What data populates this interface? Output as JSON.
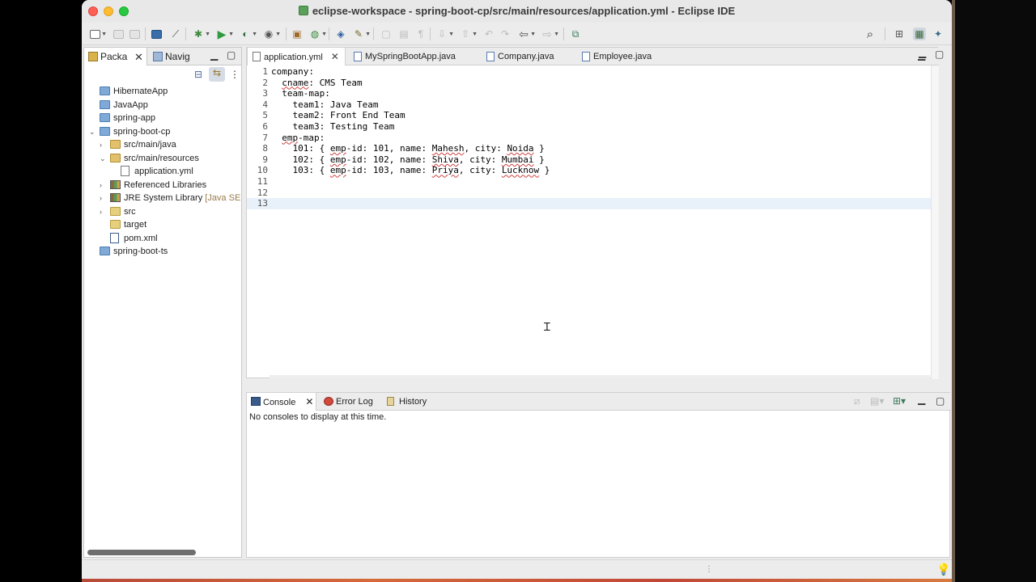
{
  "window": {
    "title": "eclipse-workspace - spring-boot-cp/src/main/resources/application.yml - Eclipse IDE"
  },
  "colors": {
    "accent": "#4a7fc1",
    "close": "#fe5f57",
    "minimize": "#febc2e",
    "maximize": "#28c840"
  },
  "left_panel": {
    "tabs": [
      {
        "label": "Packa",
        "icon": "package-explorer-icon",
        "active": true
      },
      {
        "label": "Navig",
        "icon": "navigator-icon",
        "active": false
      }
    ],
    "tree": [
      {
        "label": "HibernateApp",
        "icon": "project-icon",
        "indent": 0,
        "twisty": ""
      },
      {
        "label": "JavaApp",
        "icon": "project-icon",
        "indent": 0,
        "twisty": ""
      },
      {
        "label": "spring-app",
        "icon": "project-icon",
        "indent": 0,
        "twisty": ""
      },
      {
        "label": "spring-boot-cp",
        "icon": "project-icon",
        "indent": 0,
        "twisty": "⌄"
      },
      {
        "label": "src/main/java",
        "icon": "source-folder-icon",
        "indent": 1,
        "twisty": "›"
      },
      {
        "label": "src/main/resources",
        "icon": "source-folder-icon",
        "indent": 1,
        "twisty": "⌄"
      },
      {
        "label": "application.yml",
        "icon": "yaml-file-icon",
        "indent": 2,
        "twisty": ""
      },
      {
        "label": "Referenced Libraries",
        "icon": "library-icon",
        "indent": 1,
        "twisty": "›"
      },
      {
        "label": "JRE System Library",
        "suffix": "[Java SE",
        "icon": "library-icon",
        "indent": 1,
        "twisty": "›"
      },
      {
        "label": "src",
        "icon": "folder-icon",
        "indent": 1,
        "twisty": "›"
      },
      {
        "label": "target",
        "icon": "folder-icon",
        "indent": 1,
        "twisty": ""
      },
      {
        "label": "pom.xml",
        "icon": "maven-file-icon",
        "indent": 1,
        "twisty": ""
      },
      {
        "label": "spring-boot-ts",
        "icon": "project-icon",
        "indent": 0,
        "twisty": ""
      }
    ]
  },
  "editor": {
    "tabs": [
      {
        "label": "application.yml",
        "icon": "yaml-file-icon",
        "active": true
      },
      {
        "label": "MySpringBootApp.java",
        "icon": "java-file-icon",
        "active": false
      },
      {
        "label": "Company.java",
        "icon": "java-file-icon",
        "active": false
      },
      {
        "label": "Employee.java",
        "icon": "java-file-icon",
        "active": false
      }
    ],
    "lines": [
      {
        "n": "1",
        "text": "company:"
      },
      {
        "n": "2",
        "text": "  cname: CMS Team"
      },
      {
        "n": "3",
        "text": "  team-map:"
      },
      {
        "n": "4",
        "text": "    team1: Java Team"
      },
      {
        "n": "5",
        "text": "    team2: Front End Team"
      },
      {
        "n": "6",
        "text": "    team3: Testing Team"
      },
      {
        "n": "7",
        "text": "  emp-map:"
      },
      {
        "n": "8",
        "text": "    101: { emp-id: 101, name: Mahesh, city: Noida }"
      },
      {
        "n": "9",
        "text": "    102: { emp-id: 102, name: Shiva, city: Mumbai }"
      },
      {
        "n": "10",
        "text": "    103: { emp-id: 103, name: Priya, city: Lucknow }"
      },
      {
        "n": "11",
        "text": ""
      },
      {
        "n": "12",
        "text": ""
      },
      {
        "n": "13",
        "text": ""
      }
    ],
    "current_line": "13"
  },
  "console": {
    "tabs": [
      {
        "label": "Console",
        "icon": "console-icon",
        "active": true
      },
      {
        "label": "Error Log",
        "icon": "error-log-icon",
        "active": false
      },
      {
        "label": "History",
        "icon": "history-icon",
        "active": false
      }
    ],
    "message": "No consoles to display at this time."
  }
}
